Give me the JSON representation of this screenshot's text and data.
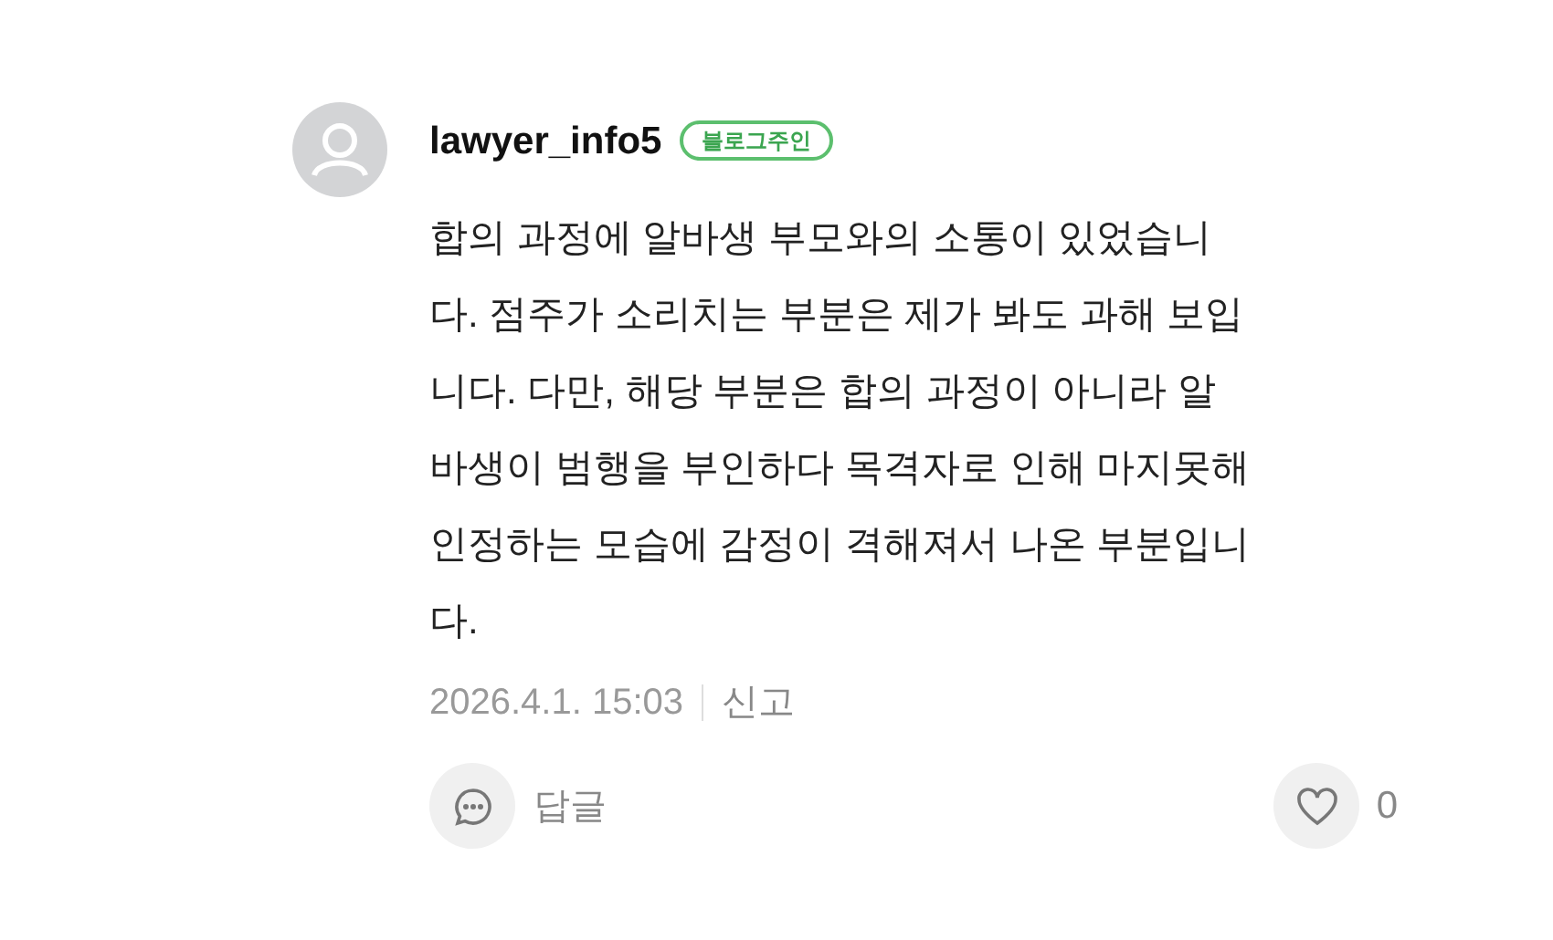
{
  "comment": {
    "username": "lawyer_info5",
    "badge": "블로그주인",
    "text_lines": [
      "합의 과정에 알바생 부모와의 소통이 있었습니",
      "다. 점주가 소리치는 부분은 제가 봐도 과해 보입",
      "니다. 다만, 해당 부분은 합의 과정이 아니라 알",
      "바생이 범행을 부인하다 목격자로 인해 마지못해",
      "인정하는 모습에 감정이 격해져서 나온 부분입니",
      "다."
    ],
    "date": "2026.4.1. 15:03",
    "report": "신고",
    "reply": "답글",
    "likes": "0",
    "liked": false
  }
}
